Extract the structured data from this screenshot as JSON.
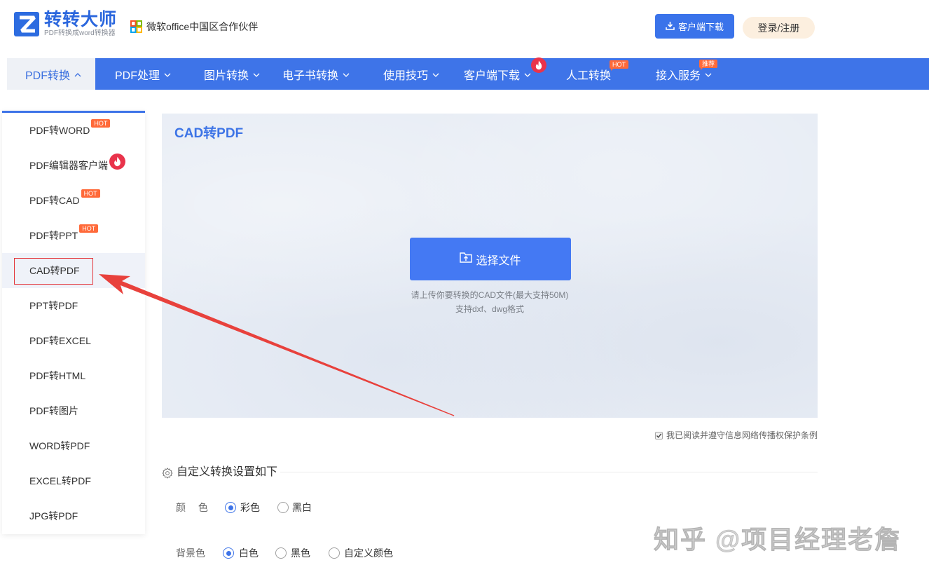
{
  "header": {
    "logo_icon": "zhuanzhuan-logo-icon",
    "logo_title": "转转大师",
    "logo_subtitle": "PDF转换成word转换器",
    "partner_icon": "office-partner-icon",
    "partner_text": "微软office中国区合作伙伴",
    "download_button": {
      "label": "客户端下载",
      "icon": "download-icon"
    },
    "login_button": "登录/注册"
  },
  "nav": {
    "items": [
      {
        "label": "PDF转换",
        "active": true,
        "icon": "chevron-up-icon"
      },
      {
        "label": "PDF处理",
        "icon": "chevron-down-icon"
      },
      {
        "label": "图片转换",
        "icon": "chevron-down-icon"
      },
      {
        "label": "电子书转换",
        "icon": "chevron-down-icon"
      },
      {
        "label": "使用技巧",
        "icon": "chevron-down-icon"
      },
      {
        "label": "客户端下载",
        "icon": "chevron-down-icon",
        "badge_icon": "fire-icon"
      },
      {
        "label": "人工转换",
        "badge": "HOT"
      },
      {
        "label": "接入服务",
        "icon": "chevron-down-icon",
        "badge": "推荐"
      }
    ]
  },
  "sidebar": {
    "items": [
      {
        "label": "PDF转WORD",
        "badge": "HOT"
      },
      {
        "label": "PDF编辑器客户端",
        "badge_icon": "fire-icon"
      },
      {
        "label": "PDF转CAD",
        "badge": "HOT"
      },
      {
        "label": "PDF转PPT",
        "badge": "HOT"
      },
      {
        "label": "CAD转PDF",
        "selected": true,
        "highlighted": true
      },
      {
        "label": "PPT转PDF"
      },
      {
        "label": "PDF转EXCEL"
      },
      {
        "label": "PDF转HTML"
      },
      {
        "label": "PDF转图片"
      },
      {
        "label": "WORD转PDF"
      },
      {
        "label": "EXCEL转PDF"
      },
      {
        "label": "JPG转PDF"
      }
    ]
  },
  "upload": {
    "title": "CAD转PDF",
    "select_button": {
      "label": "选择文件",
      "icon": "folder-upload-icon"
    },
    "hint_line1": "请上传你要转换的CAD文件(最大支持50M)",
    "hint_line2": "支持dxf、dwg格式"
  },
  "agreement": {
    "checked": true,
    "text": "我已阅读并遵守信息网络传播权保护条例"
  },
  "settings": {
    "icon": "gear-icon",
    "heading": "自定义转换设置如下",
    "color": {
      "label": "颜 色",
      "options": [
        {
          "label": "彩色",
          "checked": true
        },
        {
          "label": "黑白",
          "checked": false
        }
      ]
    },
    "background": {
      "label": "背景色",
      "options": [
        {
          "label": "白色",
          "checked": true
        },
        {
          "label": "黑色",
          "checked": false
        },
        {
          "label": "自定义颜色",
          "checked": false
        }
      ]
    }
  },
  "annotation": {
    "icon": "red-arrow-icon"
  },
  "watermark": "知乎 @项目经理老詹",
  "colors": {
    "primary": "#3e74e8",
    "hot_badge": "#ff6a3a",
    "fire_badge": "#e9334b",
    "annotation_red": "#e8413c",
    "login_bg": "#fcefdf",
    "upload_panel_bg": "#e8edf5"
  }
}
